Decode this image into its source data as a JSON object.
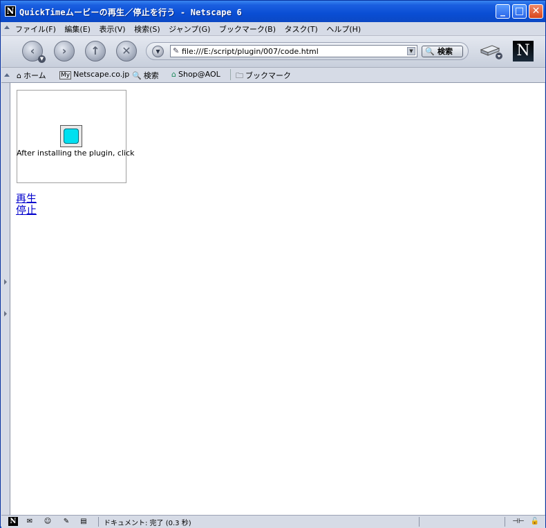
{
  "window": {
    "title": "QuickTimeムービーの再生／停止を行う - Netscape 6",
    "app_icon": "N",
    "minimize": "_",
    "maximize": "□",
    "close": "✕"
  },
  "menu": {
    "items": [
      "ファイル(F)",
      "編集(E)",
      "表示(V)",
      "検索(S)",
      "ジャンプ(G)",
      "ブックマーク(B)",
      "タスク(T)",
      "ヘルプ(H)"
    ]
  },
  "nav": {
    "back_glyph": "‹",
    "forward_glyph": "›",
    "reload_glyph": "↑",
    "stop_glyph": "✕",
    "url": "file:///E:/script/plugin/007/code.html",
    "search_label": "検索",
    "logo": "N"
  },
  "personal_toolbar": {
    "home": "ホーム",
    "my_icon": "My",
    "netscape": "Netscape.co.jp",
    "search": "検索",
    "shop": "Shop@AOL",
    "bookmarks": "ブックマーク"
  },
  "page": {
    "plugin_message": "After installing the plugin, click",
    "play_link": "再生",
    "stop_link": "停止"
  },
  "status": {
    "text": "ドキュメント: 完了 (0.3 秒)"
  },
  "colors": {
    "titlebar": "#0a4ed4",
    "link": "#0000cc"
  }
}
